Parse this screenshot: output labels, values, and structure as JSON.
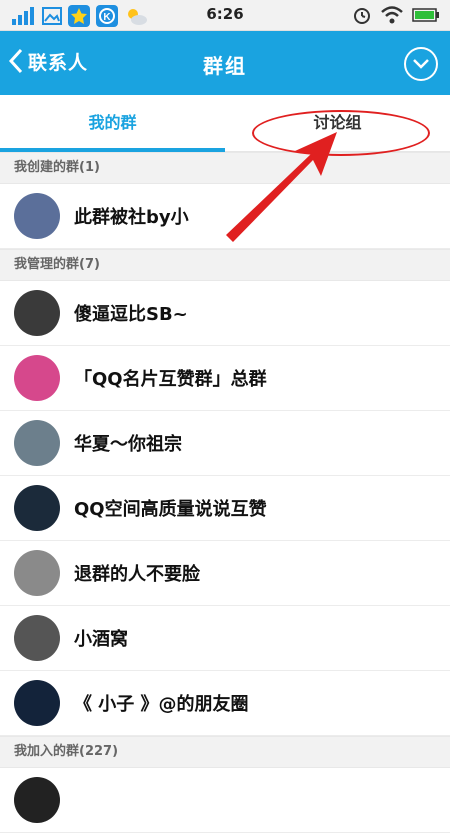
{
  "status_bar": {
    "time": "6:26",
    "battery_color": "#2fbf3a"
  },
  "nav": {
    "back_label": "联系人",
    "title": "群组",
    "more_icon": "chevron-down-circle-icon",
    "color": "#1aa3e0"
  },
  "tabs": [
    {
      "label": "我的群",
      "active": true
    },
    {
      "label": "讨论组",
      "active": false
    }
  ],
  "sections": [
    {
      "header": "我创建的群(1)",
      "items": [
        {
          "name": "此群被社by小",
          "avatar": "doraemon-avatar",
          "avatar_color": "#5b6f9a"
        }
      ]
    },
    {
      "header": "我管理的群(7)",
      "items": [
        {
          "name": "傻逼逗比SB~",
          "avatar": "person-avatar",
          "avatar_color": "#3a3a3a"
        },
        {
          "name": "「QQ名片互赞群」总群",
          "avatar": "zan-avatar",
          "avatar_color": "#d6488c"
        },
        {
          "name": "华夏～你祖宗",
          "avatar": "girl-avatar",
          "avatar_color": "#6c7f8c"
        },
        {
          "name": "QQ空间高质量说说互赞",
          "avatar": "night-avatar",
          "avatar_color": "#1b2a3a"
        },
        {
          "name": "退群的人不要脸",
          "avatar": "gray-avatar",
          "avatar_color": "#8a8a8a"
        },
        {
          "name": "小酒窝",
          "avatar": "text-avatar",
          "avatar_color": "#555555"
        },
        {
          "name": "《 小子 》@的朋友圈",
          "avatar": "cross-avatar",
          "avatar_color": "#13233a"
        }
      ]
    },
    {
      "header": "我加入的群(227)",
      "items": [
        {
          "name": "",
          "avatar": "partial-avatar",
          "avatar_color": "#222222"
        }
      ]
    }
  ]
}
